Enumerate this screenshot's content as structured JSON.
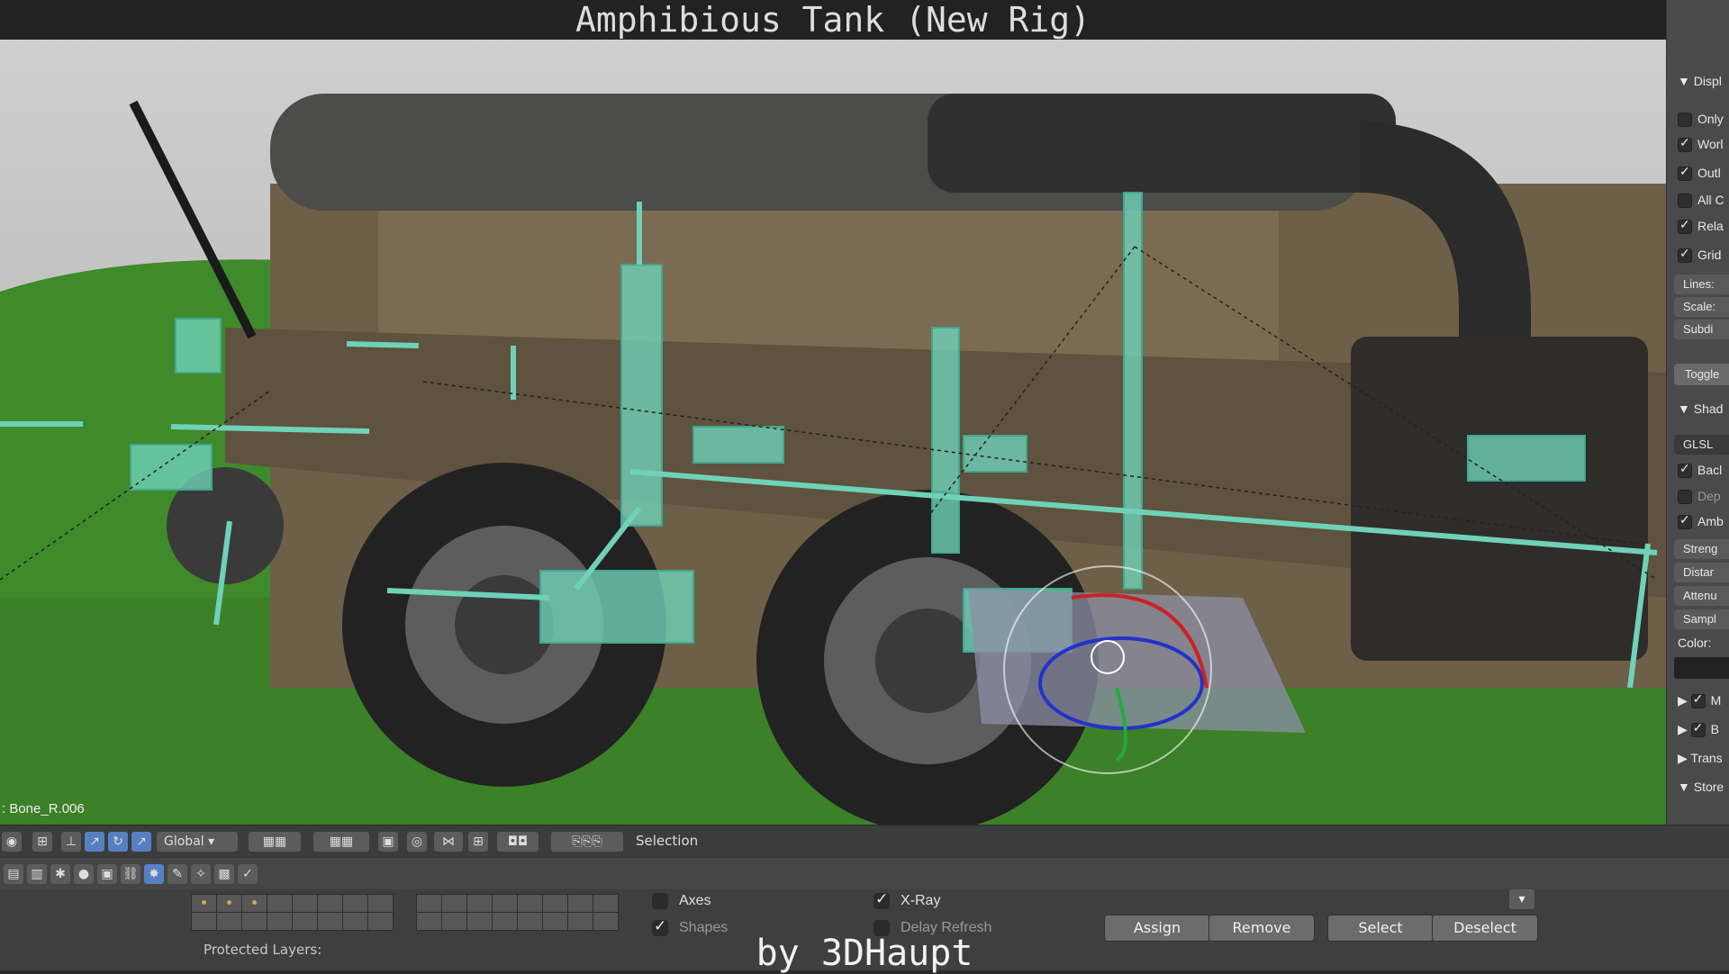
{
  "title": "Amphibious Tank (New Rig)",
  "watermark": "by 3DHaupt",
  "viewport": {
    "active_bone": ": Bone_R.006"
  },
  "right_panel": {
    "items": [
      {
        "label": "Displ",
        "type": "header"
      },
      {
        "label": "Only",
        "checked": false
      },
      {
        "label": "Worl",
        "checked": true
      },
      {
        "label": "Outl",
        "checked": true
      },
      {
        "label": "All C",
        "checked": false
      },
      {
        "label": "Rela",
        "checked": true
      },
      {
        "label": "Grid",
        "checked": true
      },
      {
        "label": "Lines:",
        "type": "field"
      },
      {
        "label": "Scale:",
        "type": "field"
      },
      {
        "label": "Subdi",
        "type": "field"
      },
      {
        "label": "Toggle",
        "type": "button"
      },
      {
        "label": "Shad",
        "type": "header"
      },
      {
        "label": "GLSL",
        "type": "dropdown"
      },
      {
        "label": "Bacl",
        "checked": true
      },
      {
        "label": "Dep",
        "checked": false
      },
      {
        "label": "Amb",
        "checked": true
      },
      {
        "label": "Streng",
        "type": "field"
      },
      {
        "label": "Distar",
        "type": "field"
      },
      {
        "label": "Attenu",
        "type": "field"
      },
      {
        "label": "Sampl",
        "type": "field"
      },
      {
        "label": "Color:",
        "type": "label"
      },
      {
        "label": "M",
        "checked": true
      },
      {
        "label": "B",
        "checked": true
      },
      {
        "label": "Trans",
        "type": "header"
      },
      {
        "label": "Store",
        "type": "header"
      }
    ]
  },
  "toolbar": {
    "orientation": "Global",
    "selection_label": "Selection"
  },
  "bottom": {
    "axes_label": "Axes",
    "axes_checked": false,
    "shapes_label": "Shapes",
    "shapes_checked": true,
    "xray_label": "X-Ray",
    "xray_checked": true,
    "delay_label": "Delay Refresh",
    "delay_checked": false,
    "protected_label": "Protected Layers:",
    "buttons": [
      "Assign",
      "Remove",
      "Select",
      "Deselect"
    ]
  },
  "colors": {
    "bone": "#6fd1b8",
    "ground": "#3f8a2a",
    "hull": "#7a6a52"
  }
}
